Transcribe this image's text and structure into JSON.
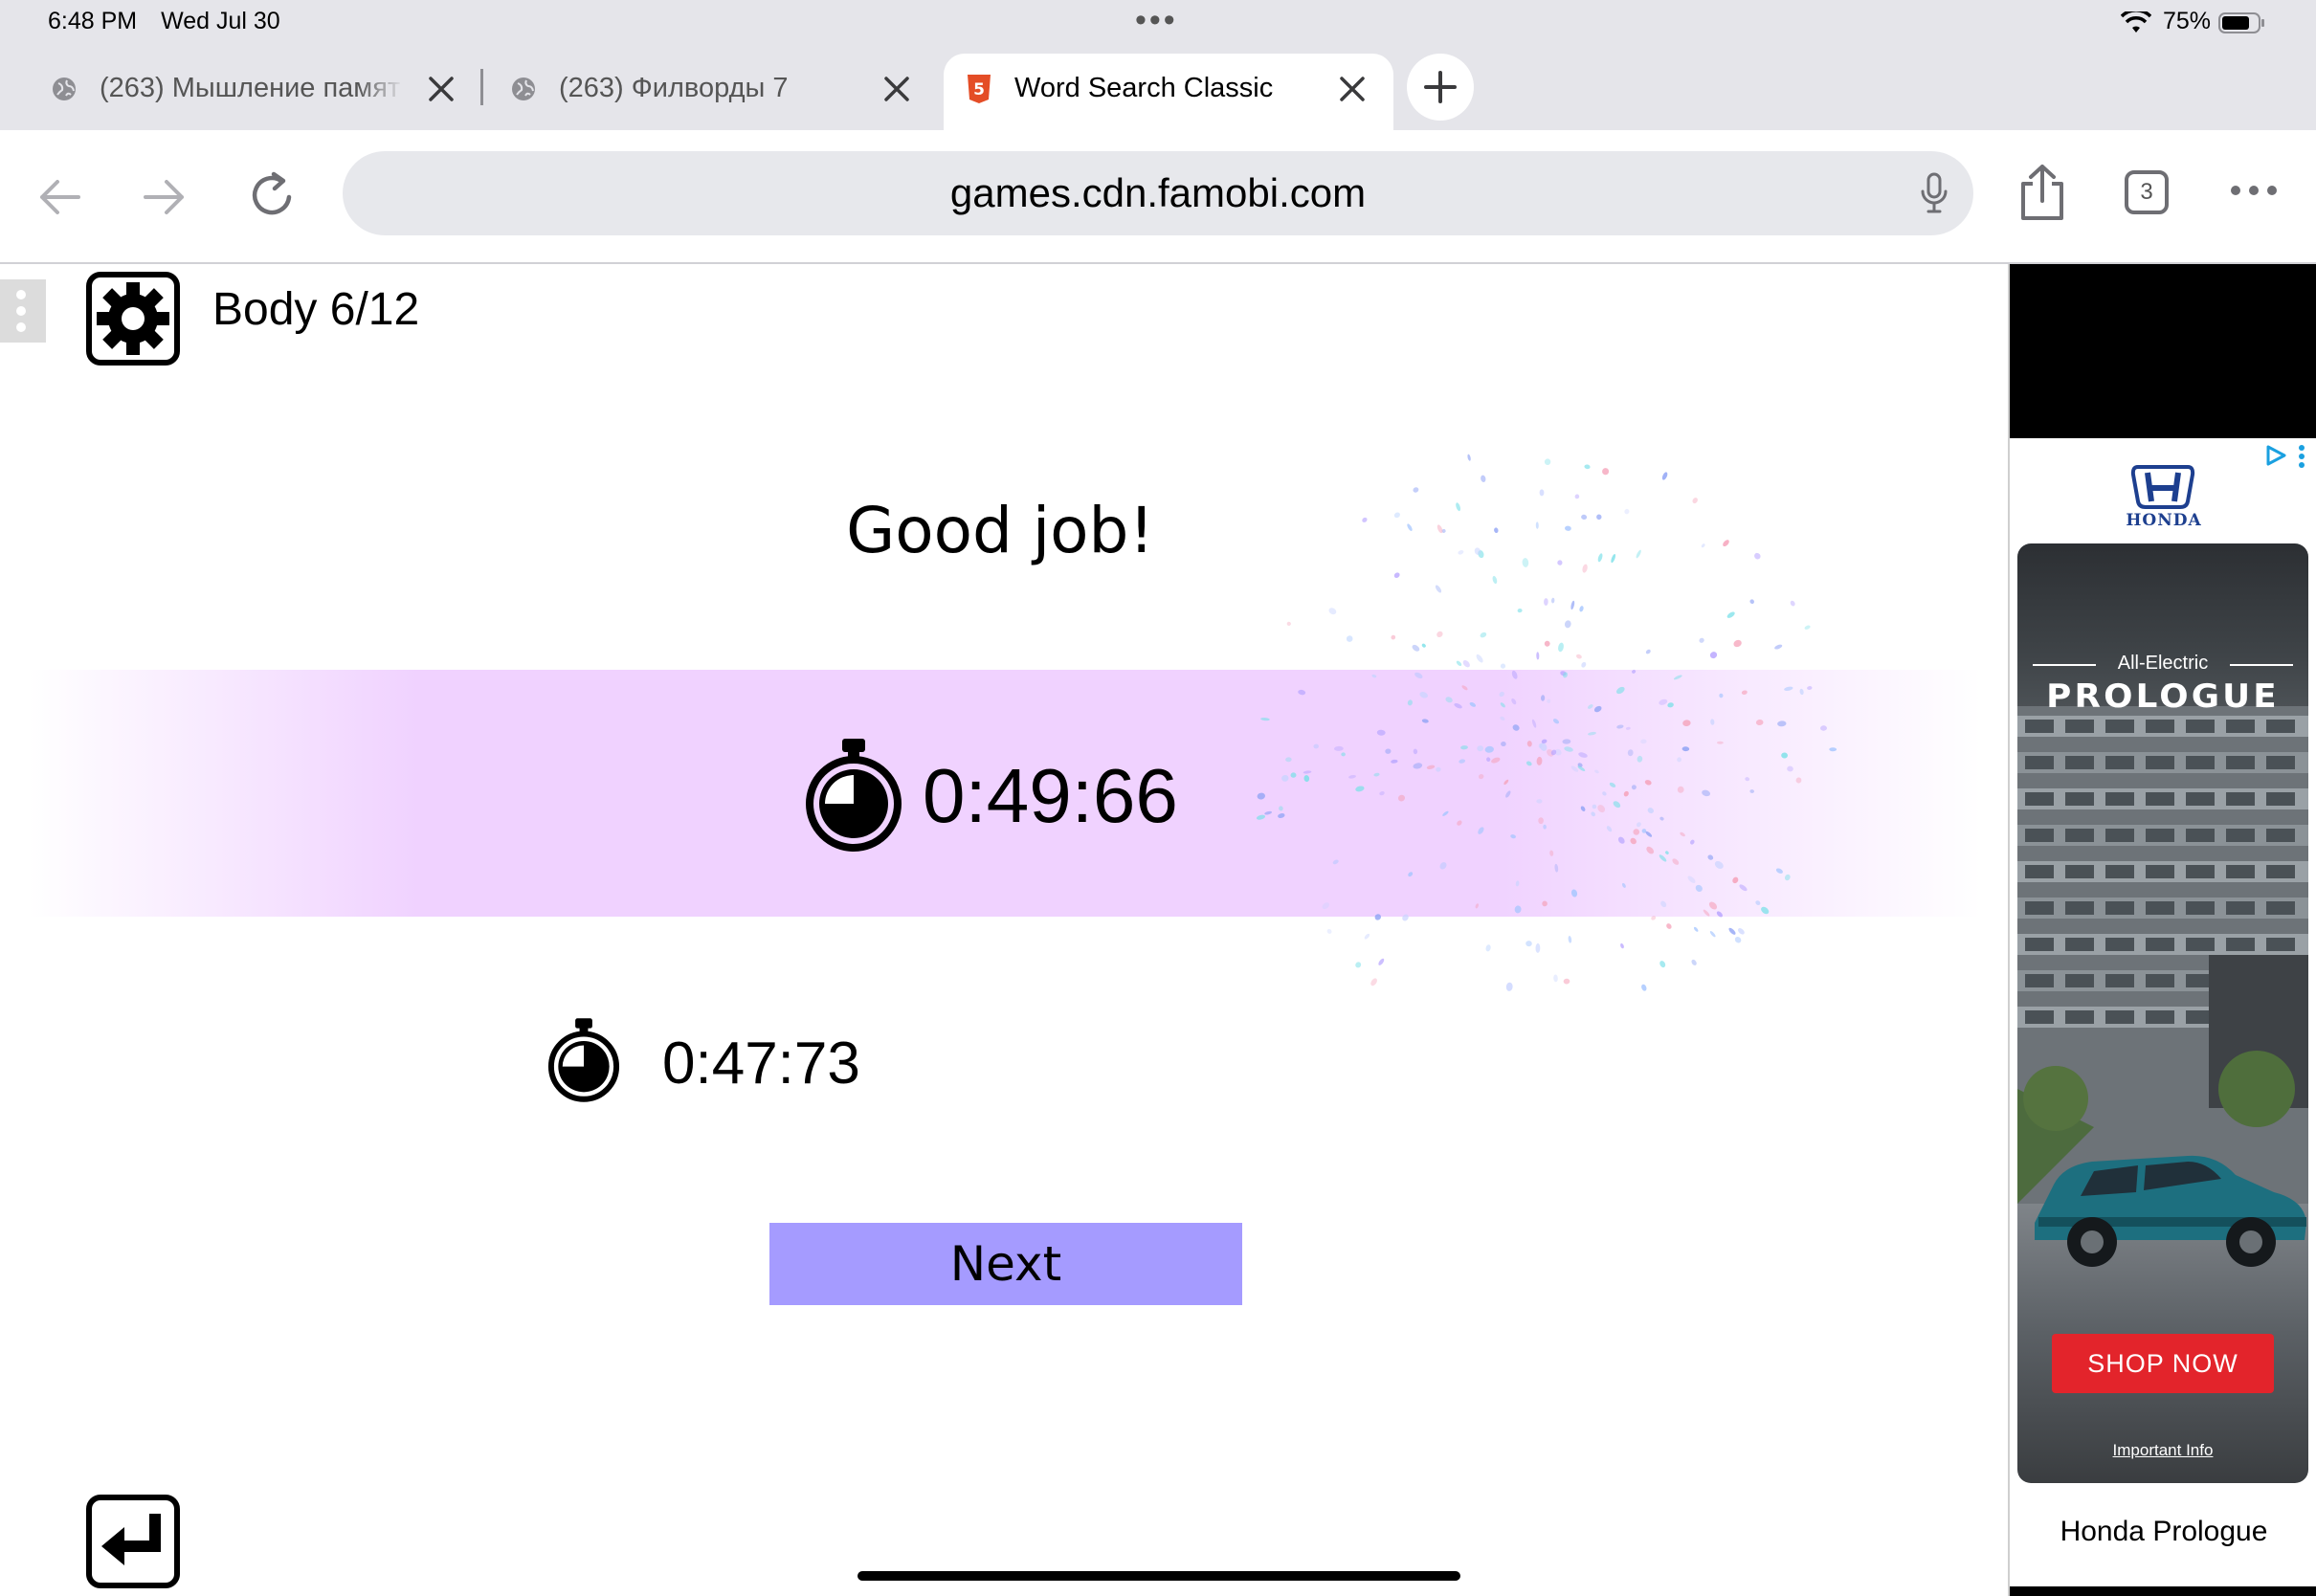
{
  "status_bar": {
    "time": "6:48 PM",
    "date": "Wed Jul 30",
    "battery_percent": "75%"
  },
  "tabs": [
    {
      "title": "(263) Мышление памят",
      "icon": "globe-icon"
    },
    {
      "title": "(263) Филворды 7",
      "icon": "globe-icon"
    },
    {
      "title": "Word Search Classic",
      "icon": "html5-icon",
      "active": true
    }
  ],
  "toolbar": {
    "url": "games.cdn.famobi.com",
    "tab_count": "3"
  },
  "game": {
    "level_label": "Body 6/12",
    "result_title": "Good job!",
    "current_time": "0:49:66",
    "best_time": "0:47:73",
    "next_label": "Next",
    "band_color": "#f0d2ff",
    "button_color": "#a59bff"
  },
  "ad": {
    "brand": "HONDA",
    "tagline": "All-Electric",
    "model": "PROLOGUE",
    "cta": "SHOP NOW",
    "info_link": "Important Info",
    "caption": "Honda Prologue",
    "cta_color": "#e3242b"
  }
}
